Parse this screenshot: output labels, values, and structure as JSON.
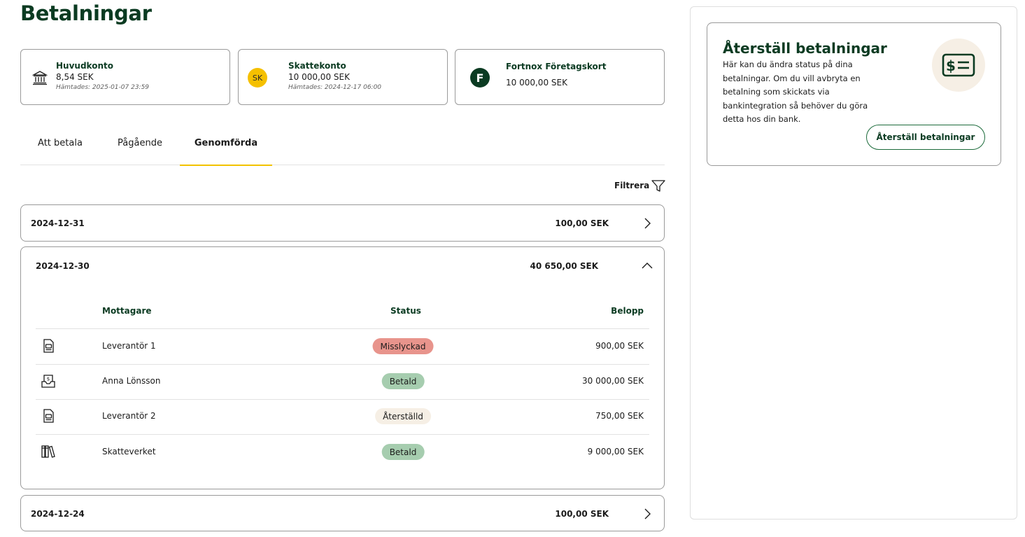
{
  "page": {
    "title": "Betalningar"
  },
  "accounts": [
    {
      "name": "Huvudkonto",
      "balance": "8,54 SEK",
      "fetched": "Hämtades: 2025-01-07 23:59",
      "icon": "bank-icon"
    },
    {
      "name": "Skattekonto",
      "balance": "10 000,00 SEK",
      "fetched": "Hämtades: 2024-12-17 06:00",
      "badge": "SK",
      "icon": "tax-account-badge"
    },
    {
      "name": "Fortnox Företagskort",
      "balance": "10 000,00 SEK",
      "badge": "F",
      "icon": "fortnox-logo"
    }
  ],
  "tabs": [
    {
      "label": "Att betala"
    },
    {
      "label": "Pågående"
    },
    {
      "label": "Genomförda",
      "active": true
    }
  ],
  "filter": {
    "label": "Filtrera",
    "icon": "funnel-icon"
  },
  "groups": [
    {
      "date": "2024-12-31",
      "total": "100,00 SEK",
      "expanded": false
    },
    {
      "date": "2024-12-30",
      "total": "40 650,00 SEK",
      "expanded": true,
      "headers": {
        "recipient": "Mottagare",
        "status": "Status",
        "amount": "Belopp"
      },
      "rows": [
        {
          "icon": "invoice-icon",
          "recipient": "Leverantör 1",
          "status": "Misslyckad",
          "status_color": "#e8948c",
          "amount": "900,00 SEK"
        },
        {
          "icon": "salary-icon",
          "recipient": "Anna Lönsson",
          "status": "Betald",
          "status_color": "#a6cdaf",
          "amount": "30 000,00 SEK"
        },
        {
          "icon": "invoice-icon",
          "recipient": "Leverantör 2",
          "status": "Återställd",
          "status_color": "#f6efe5",
          "amount": "750,00 SEK"
        },
        {
          "icon": "tax-books-icon",
          "recipient": "Skatteverket",
          "status": "Betald",
          "status_color": "#a6cdaf",
          "amount": "9 000,00 SEK"
        }
      ]
    },
    {
      "date": "2024-12-24",
      "total": "100,00 SEK",
      "expanded": false
    }
  ],
  "reset_panel": {
    "title": "Återställ betalningar",
    "description": "Här kan du ändra status på dina betalningar. Om du vill avbryta en betalning som skickats via bankintegration så behöver du göra detta hos din bank.",
    "button_label": "Återställ betalningar",
    "icon": "dollar-card-icon"
  },
  "colors": {
    "brand_dark_green": "#0b3b22",
    "tab_indicator": "#f2c200",
    "sk_badge": "#f5c000",
    "illustration_bg": "#f6efe5"
  }
}
